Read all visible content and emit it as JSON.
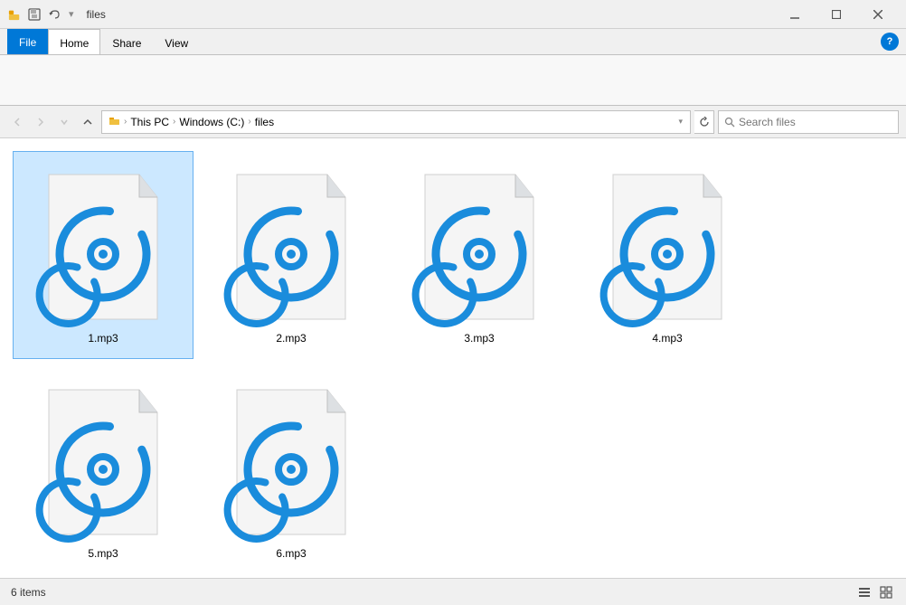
{
  "titlebar": {
    "icon_name": "folder-icon",
    "title": "files",
    "minimize_label": "Minimize",
    "maximize_label": "Maximize",
    "close_label": "Close"
  },
  "ribbon": {
    "tabs": [
      {
        "id": "file",
        "label": "File"
      },
      {
        "id": "home",
        "label": "Home"
      },
      {
        "id": "share",
        "label": "Share"
      },
      {
        "id": "view",
        "label": "View"
      }
    ],
    "active_tab": "home"
  },
  "addressbar": {
    "back_title": "Back",
    "forward_title": "Forward",
    "up_title": "Up",
    "path_parts": [
      {
        "label": "This PC"
      },
      {
        "label": "Windows (C:)"
      },
      {
        "label": "files"
      }
    ],
    "search_placeholder": "Search files",
    "search_label": "Search"
  },
  "files": [
    {
      "id": 1,
      "name": "1.mp3",
      "selected": true
    },
    {
      "id": 2,
      "name": "2.mp3",
      "selected": false
    },
    {
      "id": 3,
      "name": "3.mp3",
      "selected": false
    },
    {
      "id": 4,
      "name": "4.mp3",
      "selected": false
    },
    {
      "id": 5,
      "name": "5.mp3",
      "selected": false
    },
    {
      "id": 6,
      "name": "6.mp3",
      "selected": false
    }
  ],
  "statusbar": {
    "count_label": "6 items",
    "help_icon": "?"
  },
  "colors": {
    "accent": "#0078d7",
    "mp3_blue": "#1a8cdc"
  }
}
